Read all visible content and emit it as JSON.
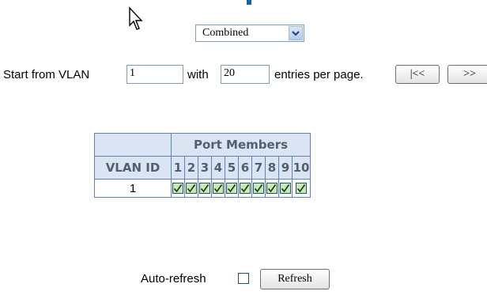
{
  "view": {
    "selected": "Combined"
  },
  "paging": {
    "start_label": "Start from VLAN",
    "start_value": "1",
    "with_label": "with",
    "entries_value": "20",
    "entries_label": "entries per page.",
    "first_button": "|<<",
    "next_button": ">>"
  },
  "table": {
    "group_header": "Port Members",
    "vlan_id_header": "VLAN ID",
    "ports": [
      "1",
      "2",
      "3",
      "4",
      "5",
      "6",
      "7",
      "8",
      "9",
      "10"
    ],
    "rows": [
      {
        "vlan_id": "1",
        "members": [
          true,
          true,
          true,
          true,
          true,
          true,
          true,
          true,
          true,
          true
        ]
      }
    ]
  },
  "footer": {
    "autorefresh_label": "Auto-refresh",
    "autorefresh_checked": false,
    "refresh_button": "Refresh"
  },
  "colors": {
    "header_bg": "#dbe4f2",
    "border": "#5d84b8",
    "checkbox_fill": "#c9e8b2"
  }
}
